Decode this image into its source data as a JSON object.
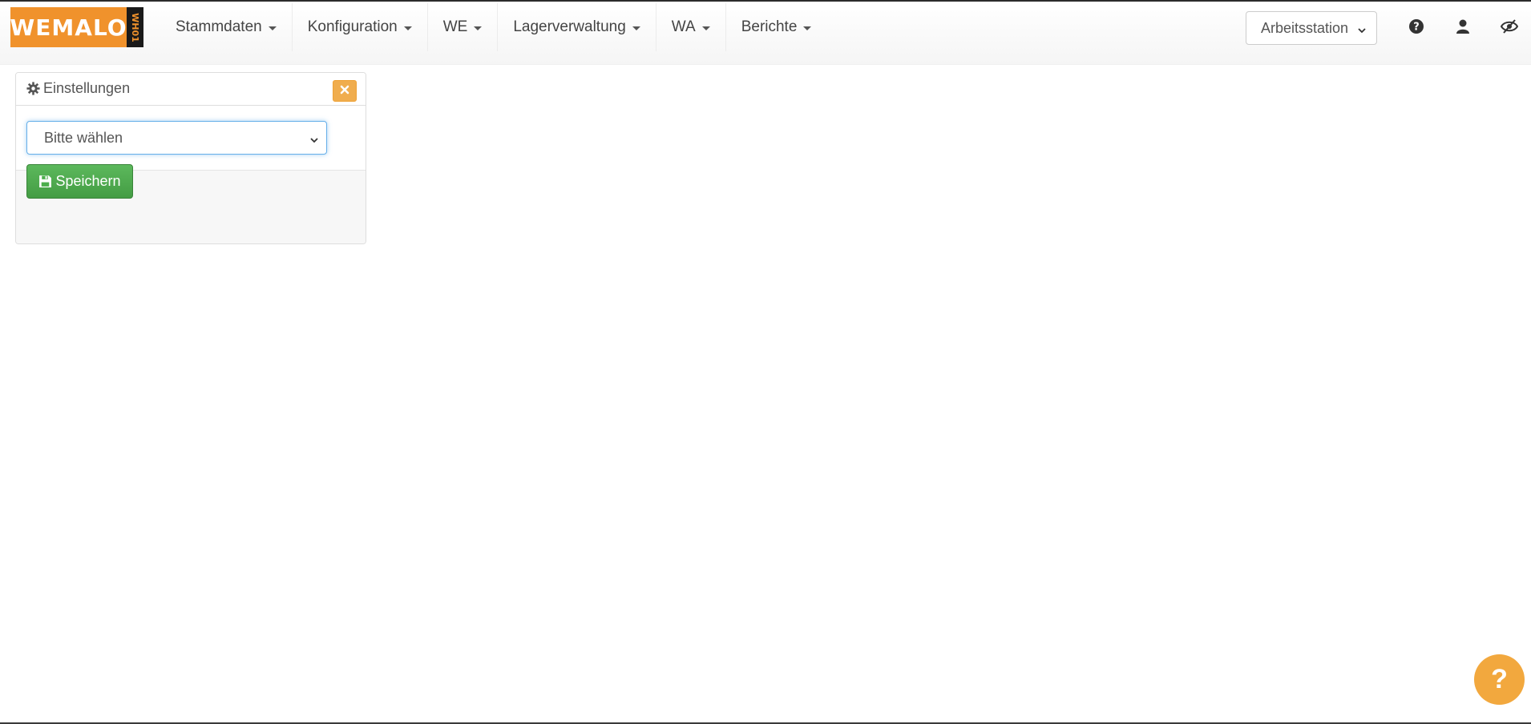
{
  "logo": {
    "text": "WEMALO",
    "side_text": "WH01",
    "colors": {
      "orange": "#f0922c",
      "dark": "#1a1a1a"
    }
  },
  "nav": {
    "items": [
      {
        "label": "Stammdaten",
        "icon": "caret-down-icon"
      },
      {
        "label": "Konfiguration",
        "icon": "caret-down-icon"
      },
      {
        "label": "WE",
        "icon": "caret-down-icon"
      },
      {
        "label": "Lagerverwaltung",
        "icon": "caret-down-icon"
      },
      {
        "label": "WA",
        "icon": "caret-down-icon"
      },
      {
        "label": "Berichte",
        "icon": "caret-down-icon"
      }
    ],
    "workstation": {
      "value": "Arbeitsstation",
      "icon": "chevron-down-icon"
    },
    "icons": [
      "question-circle-icon",
      "user-icon",
      "eye-slash-icon"
    ]
  },
  "settings_panel": {
    "title": "Einstellungen",
    "title_icon": "gear-icon",
    "close_icon": "close-icon",
    "select": {
      "value": "Bitte wählen",
      "icon": "chevron-down-icon"
    },
    "save_button": {
      "label": "Speichern",
      "icon": "floppy-disk-icon"
    }
  },
  "help_fab": {
    "label": "?"
  },
  "colors": {
    "accent_orange": "#f0ad4e",
    "success_green": "#5cb85c",
    "focus_blue": "#66afe9"
  }
}
